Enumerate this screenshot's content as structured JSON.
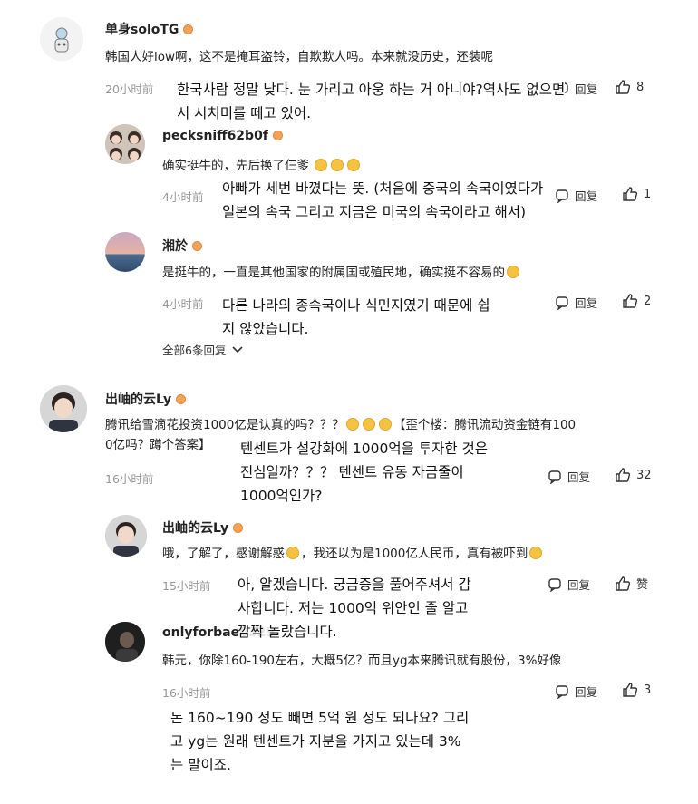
{
  "comments": [
    {
      "user": "单身soloTG",
      "text": "韩国人好low啊，这不是掩耳盗铃，自欺欺人吗。本来就没历史，还装呢",
      "time": "20小时前",
      "translation": [
        "한국사람 정말 낮다. 눈 가리고 아웅 하는 거 아니야?역사도 없으면",
        "서 시치미를 떼고 있어."
      ],
      "partial_reply": "回复",
      "partial_like": "8",
      "replies": [
        {
          "user": "pecksniff62b0f",
          "text": "确实挺牛的，先后换了仨爹",
          "time": "4小时前",
          "reply_label": "回复",
          "likes": "1",
          "translation": [
            "아빠가 세번 바꼈다는 뜻. (처음에 중국의 속국이였다가",
            "일본의 속국 그리고 지금은 미국의 속국이라고 해서)"
          ]
        },
        {
          "user": "湘於",
          "text": "是挺牛的，一直是其他国家的附属国或殖民地，确实挺不容易的",
          "time": "4小时前",
          "reply_label": "回复",
          "likes": "2",
          "translation": [
            "다른 나라의 종속국이나 식민지였기 때문에 쉽",
            "지 않았습니다."
          ]
        }
      ],
      "expand_label": "全部6条回复"
    },
    {
      "user": "出岫的云Ly",
      "text_line1": "腾讯给雪滴花投资1000亿是认真的吗？？？",
      "text_line1b": "【歪个楼：腾讯流动资金链有100",
      "text_line2": "0亿吗？蹲个答案】",
      "time": "16小时前",
      "reply_label": "回复",
      "likes": "32",
      "translation": [
        "텐센트가 설강화에 1000억을 투자한 것은",
        "진심일까？？？  텐센트 유동 자금줄이",
        "1000억인가?"
      ],
      "replies": [
        {
          "user": "出岫的云Ly",
          "text": "哦，了解了，感谢解惑",
          "text_b": "，我还以为是1000亿人民币，真有被吓到",
          "time": "15小时前",
          "reply_label": "回复",
          "likes": "赞",
          "translation": [
            "아, 알겠습니다. 궁금증을 풀어주셔서 감",
            "사합니다. 저는 1000억 위안인 줄 알고",
            "깜짝 놀랐습니다."
          ]
        },
        {
          "user": "onlyforbae0329",
          "text": "韩元，你除160-190左右，大概5亿？而且yg本来腾讯就有股份，3%好像",
          "time": "16小时前",
          "reply_label": "回复",
          "likes": "3",
          "translation": [
            "돈 160~190 정도 빼면 5억 원 정도 되나요? 그리",
            "고 yg는 원래 텐센트가 지분을 가지고 있는데 3%",
            "는 말이죠."
          ]
        }
      ]
    }
  ]
}
